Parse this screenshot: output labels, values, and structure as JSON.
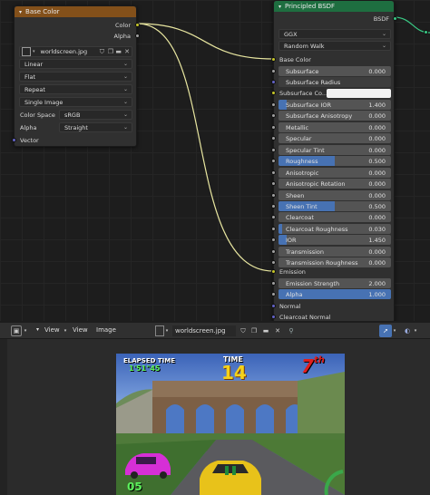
{
  "texture_node": {
    "title": "Base Color",
    "outputs": [
      "Color",
      "Alpha"
    ],
    "image_name": "worldscreen.jpg",
    "interpolation": "Linear",
    "projection": "Flat",
    "extension": "Repeat",
    "source": "Single Image",
    "color_space_label": "Color Space",
    "color_space": "sRGB",
    "alpha_label": "Alpha",
    "alpha_mode": "Straight",
    "vector_label": "Vector"
  },
  "bsdf_node": {
    "title": "Principled BSDF",
    "output": "BSDF",
    "distribution": "GGX",
    "subsurface_method": "Random Walk",
    "base_color_label": "Base Color",
    "subsurface_color_label": "Subsurface Co...",
    "emission_label": "Emission",
    "normal_label": "Normal",
    "clearcoat_normal_label": "Clearcoat Normal",
    "params": [
      {
        "label": "Subsurface",
        "value": "0.000",
        "fill": 0
      },
      {
        "label": "Subsurface Radius",
        "value": "",
        "fill": 0
      },
      {
        "label": "Subsurface IOR",
        "value": "1.400",
        "fill": 0.07
      },
      {
        "label": "Subsurface Anisotropy",
        "value": "0.000",
        "fill": 0
      },
      {
        "label": "Metallic",
        "value": "0.000",
        "fill": 0
      },
      {
        "label": "Specular",
        "value": "0.000",
        "fill": 0
      },
      {
        "label": "Specular Tint",
        "value": "0.000",
        "fill": 0
      },
      {
        "label": "Roughness",
        "value": "0.500",
        "fill": 0.5
      },
      {
        "label": "Anisotropic",
        "value": "0.000",
        "fill": 0
      },
      {
        "label": "Anisotropic Rotation",
        "value": "0.000",
        "fill": 0
      },
      {
        "label": "Sheen",
        "value": "0.000",
        "fill": 0
      },
      {
        "label": "Sheen Tint",
        "value": "0.500",
        "fill": 0.5
      },
      {
        "label": "Clearcoat",
        "value": "0.000",
        "fill": 0
      },
      {
        "label": "Clearcoat Roughness",
        "value": "0.030",
        "fill": 0.03
      },
      {
        "label": "IOR",
        "value": "1.450",
        "fill": 0.07
      },
      {
        "label": "Transmission",
        "value": "0.000",
        "fill": 0
      },
      {
        "label": "Transmission Roughness",
        "value": "0.000",
        "fill": 0
      },
      {
        "label": "Emission Strength",
        "value": "2.000",
        "fill": 0
      },
      {
        "label": "Alpha",
        "value": "1.000",
        "fill": 1
      }
    ]
  },
  "image_editor": {
    "menu_view": "View",
    "menu_view2": "View",
    "menu_image": "Image",
    "image_name": "worldscreen.jpg"
  },
  "game": {
    "elapsed_label": "ELAPSED TIME",
    "elapsed_value": "1'51\"45",
    "time_label": "TIME",
    "time_value": "14",
    "position": "7",
    "position_suffix": "th",
    "speed": "05"
  },
  "colors": {
    "texture_header": "#83501a",
    "bsdf_header": "#1e6e40",
    "accent": "#4772b3",
    "wire": "#e8e6a0"
  }
}
